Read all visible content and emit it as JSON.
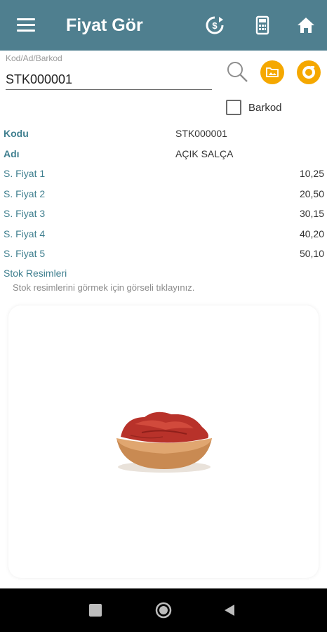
{
  "appbar": {
    "title": "Fiyat Gör",
    "icons": [
      "menu-icon",
      "refresh-currency-icon",
      "calculator-icon",
      "home-icon"
    ],
    "color": "#4f7f8f"
  },
  "search": {
    "label": "Kod/Ad/Barkod",
    "value": "STK000001",
    "barkod_label": "Barkod",
    "barkod_checked": false,
    "accent": "#f5a800"
  },
  "details": {
    "kodu_label": "Kodu",
    "kodu_value": "STK000001",
    "adi_label": "Adı",
    "adi_value": "AÇIK SALÇA",
    "prices": [
      {
        "label": "S. Fiyat 1",
        "value": "10,25"
      },
      {
        "label": "S. Fiyat 2",
        "value": "20,50"
      },
      {
        "label": "S. Fiyat 3",
        "value": "30,15"
      },
      {
        "label": "S. Fiyat 4",
        "value": "40,20"
      },
      {
        "label": "S. Fiyat 5",
        "value": "50,10"
      }
    ]
  },
  "images": {
    "title": "Stok Resimleri",
    "hint": "Stok resimlerini görmek için görseli tıklayınız."
  },
  "navbar": {
    "icons": [
      "recents-square-icon",
      "home-circle-icon",
      "back-triangle-icon"
    ]
  }
}
